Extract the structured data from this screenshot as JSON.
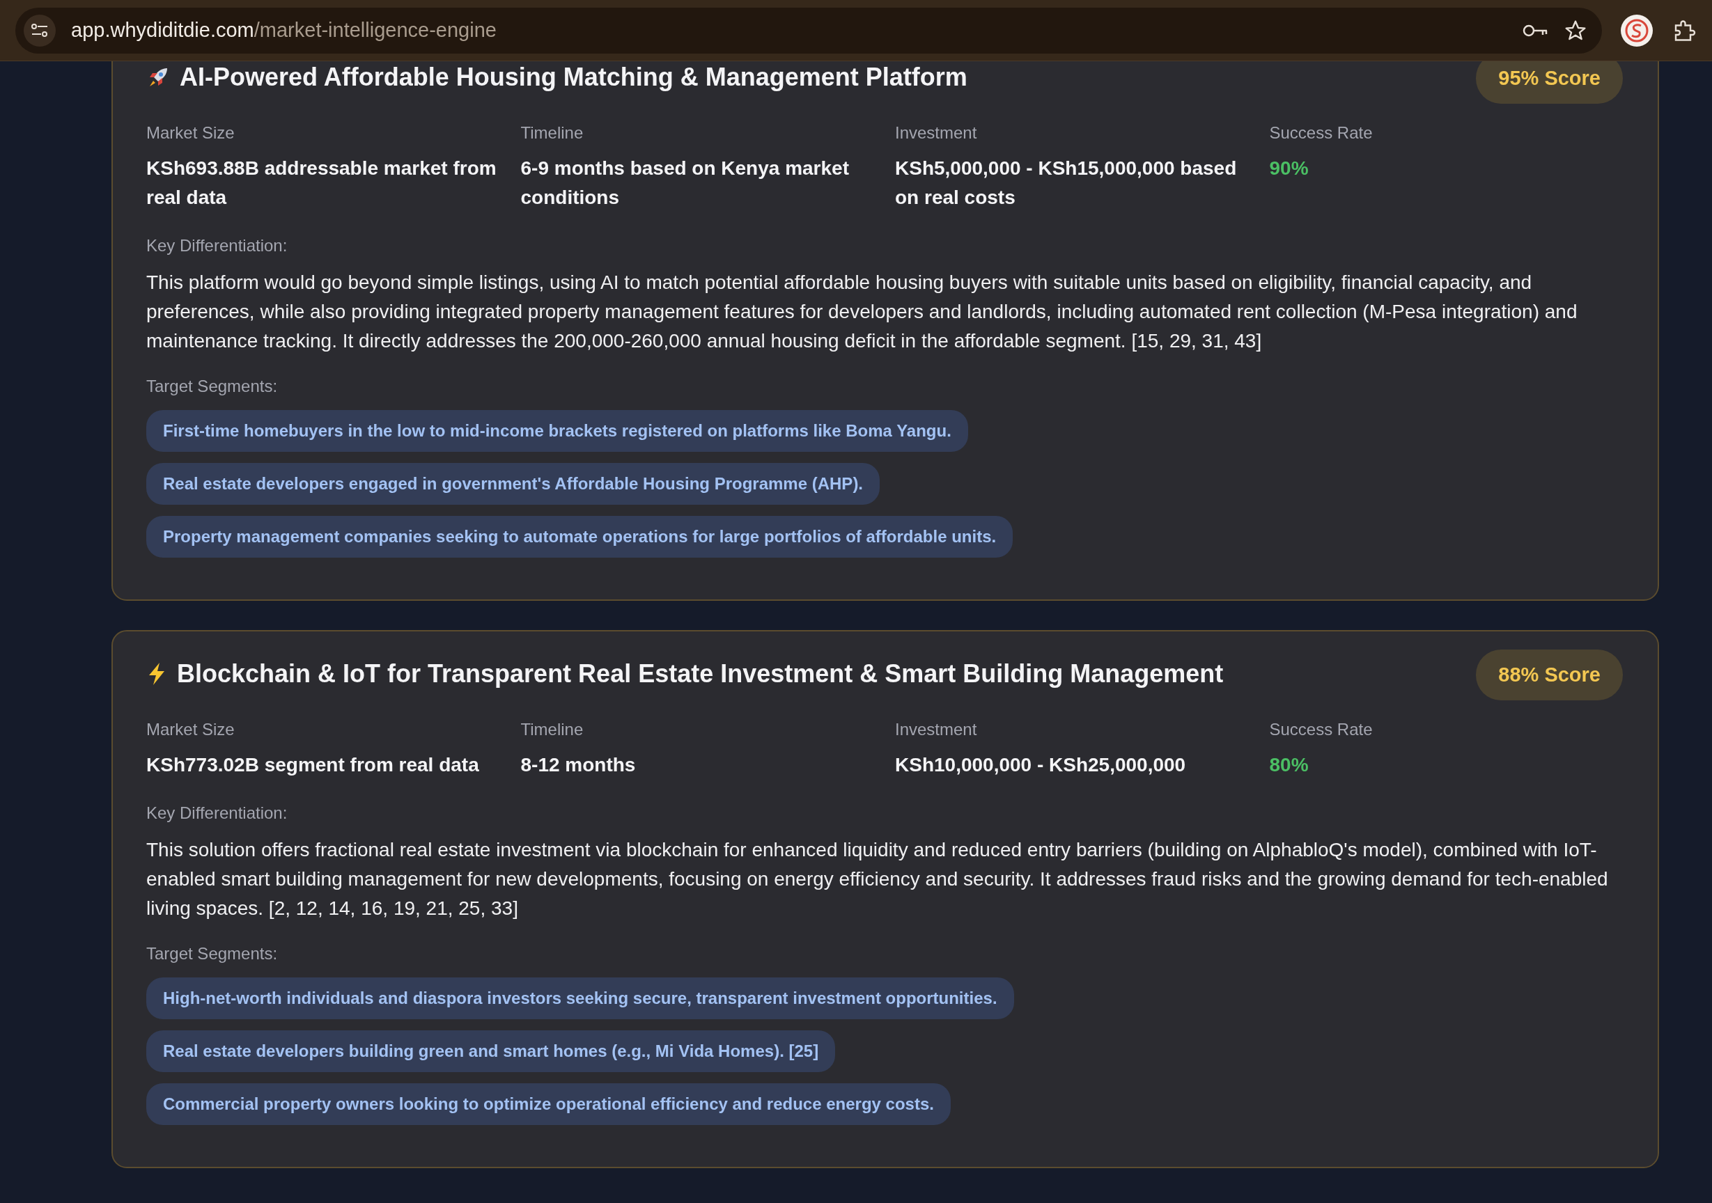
{
  "browser": {
    "url_host": "app.whydiditdie.com",
    "url_path": "/market-intelligence-engine"
  },
  "cards": [
    {
      "title": "AI-Powered Affordable Housing Matching & Management Platform",
      "score": "95% Score",
      "metrics": [
        {
          "label": "Market Size",
          "value": "KSh693.88B addressable market from real data",
          "kind": "plain"
        },
        {
          "label": "Timeline",
          "value": "6-9 months based on Kenya market conditions",
          "kind": "plain"
        },
        {
          "label": "Investment",
          "value": "KSh5,000,000 - KSh15,000,000 based on real costs",
          "kind": "plain"
        },
        {
          "label": "Success Rate",
          "value": "90%",
          "kind": "rate"
        }
      ],
      "differentiation_label": "Key Differentiation:",
      "differentiation": "This platform would go beyond simple listings, using AI to match potential affordable housing buyers with suitable units based on eligibility, financial capacity, and preferences, while also providing integrated property management features for developers and landlords, including automated rent collection (M-Pesa integration) and maintenance tracking. It directly addresses the 200,000-260,000 annual housing deficit in the affordable segment. [15, 29, 31, 43]",
      "segments_label": "Target Segments:",
      "segments": [
        "First-time homebuyers in the low to mid-income brackets registered on platforms like Boma Yangu.",
        "Real estate developers engaged in government's Affordable Housing Programme (AHP).",
        "Property management companies seeking to automate operations for large portfolios of affordable units."
      ]
    },
    {
      "title": "Blockchain & IoT for Transparent Real Estate Investment & Smart Building Management",
      "score": "88% Score",
      "metrics": [
        {
          "label": "Market Size",
          "value": "KSh773.02B segment from real data",
          "kind": "plain"
        },
        {
          "label": "Timeline",
          "value": "8-12 months",
          "kind": "plain"
        },
        {
          "label": "Investment",
          "value": "KSh10,000,000 - KSh25,000,000",
          "kind": "plain"
        },
        {
          "label": "Success Rate",
          "value": "80%",
          "kind": "rate"
        }
      ],
      "differentiation_label": "Key Differentiation:",
      "differentiation": "This solution offers fractional real estate investment via blockchain for enhanced liquidity and reduced entry barriers (building on AlphabloQ's model), combined with IoT-enabled smart building management for new developments, focusing on energy efficiency and security. It addresses fraud risks and the growing demand for tech-enabled living spaces. [2, 12, 14, 16, 19, 21, 25, 33]",
      "segments_label": "Target Segments:",
      "segments": [
        "High-net-worth individuals and diaspora investors seeking secure, transparent investment opportunities.",
        "Real estate developers building green and smart homes (e.g., Mi Vida Homes). [25]",
        "Commercial property owners looking to optimize operational efficiency and reduce energy costs."
      ]
    }
  ]
}
